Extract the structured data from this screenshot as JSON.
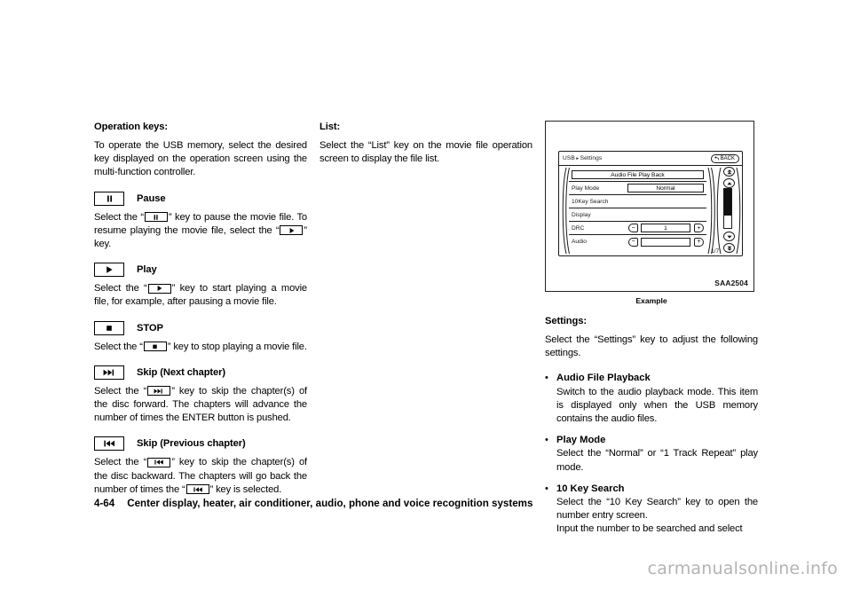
{
  "left_column": {
    "heading": "Operation keys:",
    "intro": "To operate the USB memory, select the desired key displayed on the operation screen using the multi-function controller.",
    "keys": [
      {
        "icon": "pause-icon",
        "title": "Pause",
        "desc_parts": [
          "Select the “",
          "pause-icon",
          "” key to pause the movie file. To resume playing the movie file, select the “",
          "play-icon",
          "” key."
        ]
      },
      {
        "icon": "play-icon",
        "title": "Play",
        "desc_parts": [
          "Select the “",
          "play-icon",
          "” key to start playing a movie file, for example, after pausing a movie file."
        ]
      },
      {
        "icon": "stop-icon",
        "title": "STOP",
        "desc_parts": [
          "Select the “",
          "stop-icon",
          "” key to stop playing a movie file."
        ]
      },
      {
        "icon": "skip-next-icon",
        "title": "Skip (Next chapter)",
        "desc_parts": [
          "Select the “",
          "skip-next-icon",
          "” key to skip the chapter(s) of the disc forward. The chapters will advance the number of times the ENTER button is pushed."
        ]
      },
      {
        "icon": "skip-prev-icon",
        "title": "Skip (Previous chapter)",
        "desc_parts": [
          "Select the “",
          "skip-prev-icon",
          "” key to skip the chapter(s) of the disc backward. The chapters will go back the number of times the “",
          "skip-prev-icon",
          "” key is selected."
        ]
      }
    ],
    "pause_text_a": "Select the “",
    "pause_text_b": "” key to pause the movie file. To resume playing the movie file, select the “",
    "pause_text_c": "” key.",
    "play_text_a": "Select the “",
    "play_text_b": "” key to start playing a movie file, for example, after pausing a movie file.",
    "stop_text_a": "Select the “",
    "stop_text_b": "” key to stop playing a movie file.",
    "next_text_a": "Select the “",
    "next_text_b": "” key to skip the chapter(s) of the disc forward. The chapters will advance the number of times the ENTER button is pushed.",
    "prev_text_a": "Select the “",
    "prev_text_b": "” key to skip the chapter(s) of the disc backward. The chapters will go back the number of times the “",
    "prev_text_c": "” key is selected."
  },
  "middle_column": {
    "heading": "List:",
    "body": "Select the “List” key on the movie file operation screen to display the file list."
  },
  "illustration": {
    "caption": "Example",
    "figure_id": "SAA2504",
    "screen": {
      "breadcrumb_root": "USB",
      "breadcrumb_arrow": "▸",
      "breadcrumb_leaf": "Settings",
      "back_label": "BACK",
      "back_icon": "back-arrow-icon",
      "page_count": "1/7",
      "rows": [
        {
          "label": "",
          "value": "Audio File Play Back",
          "type": "full-button"
        },
        {
          "label": "Play Mode",
          "value": "Normal",
          "type": "value-button"
        },
        {
          "label": "10Key Search",
          "value": "",
          "type": "plain"
        },
        {
          "label": "Display",
          "value": "",
          "type": "plain"
        },
        {
          "label": "DRC",
          "value": "1",
          "type": "stepper"
        },
        {
          "label": "Audio",
          "value": "",
          "type": "stepper"
        }
      ],
      "scroll_buttons": [
        "scroll-top-icon",
        "scroll-up-icon",
        "scroll-down-icon",
        "scroll-bottom-icon"
      ]
    }
  },
  "right_column": {
    "heading": "Settings:",
    "intro": "Select the “Settings” key to adjust the following settings.",
    "bullets": [
      {
        "title": "Audio File Playback",
        "desc": "Switch to the audio playback mode. This item is displayed only when the USB memory contains the audio files."
      },
      {
        "title": "Play Mode",
        "desc": "Select the “Normal” or “1 Track Repeat” play mode."
      },
      {
        "title": "10 Key Search",
        "desc": "Select the “10 Key Search” key to open the number entry screen.",
        "desc2": "Input the number to be searched and select"
      }
    ]
  },
  "footer": {
    "page_number": "4-64",
    "chapter_title": "Center display, heater, air conditioner, audio, phone and voice recognition systems"
  },
  "watermark": "carmanualsonline.info",
  "colors": {
    "text": "#000000",
    "line": "#1a1a1a",
    "watermark": "#b3b3b3",
    "scroll_thumb": "#111111"
  }
}
